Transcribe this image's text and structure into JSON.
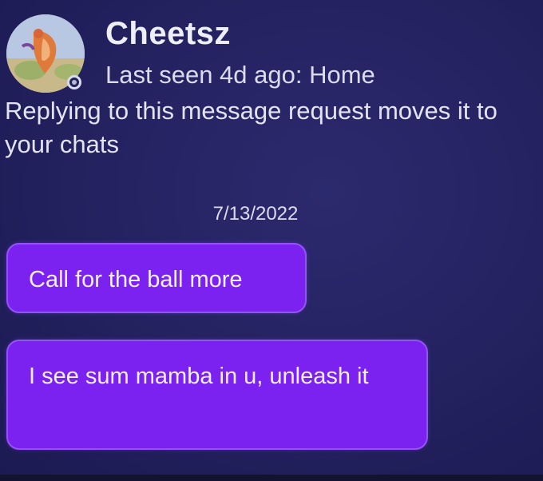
{
  "header": {
    "username": "Cheetsz",
    "status": "Last seen 4d ago: Home"
  },
  "notice": "Replying to this message request moves it to your chats",
  "conversation": {
    "date": "7/13/2022",
    "messages": [
      {
        "text": "Call for the ball more"
      },
      {
        "text": "I see sum mamba in u, unleash it"
      }
    ]
  },
  "colors": {
    "background": "#23215e",
    "bubble": "#7b22f0",
    "text": "#e7e6f5"
  },
  "icons": {
    "avatar": "profile-picture-icon",
    "presence": "presence-status-icon"
  }
}
